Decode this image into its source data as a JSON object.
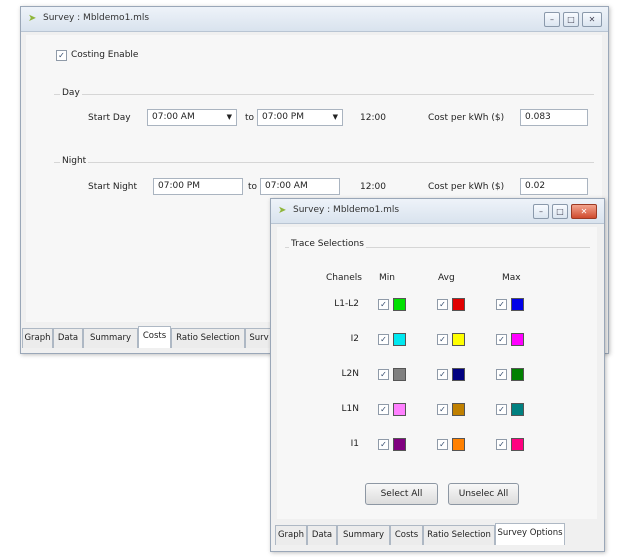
{
  "main_window": {
    "title": "Survey : Mbldemo1.mls",
    "costing_enable_label": "Costing Enable",
    "costing_enable_checked": true,
    "day": {
      "group_label": "Day",
      "start_label": "Start Day",
      "start_value": "07:00 AM",
      "to_label": "to",
      "end_value": "07:00 PM",
      "duration": "12:00",
      "cost_label": "Cost per kWh ($)",
      "cost_value": "0.083"
    },
    "night": {
      "group_label": "Night",
      "start_label": "Start Night",
      "start_value": "07:00 PM",
      "to_label": "to",
      "end_value": "07:00 AM",
      "duration": "12:00",
      "cost_label": "Cost per kWh ($)",
      "cost_value": "0.02"
    },
    "tabs": [
      "Graph",
      "Data",
      "Summary",
      "Costs",
      "Ratio Selection",
      "Surv"
    ],
    "active_tab": "Costs"
  },
  "options_window": {
    "title": "Survey : Mbldemo1.mls",
    "group_label": "Trace Selections",
    "headers": {
      "channels": "Chanels",
      "min": "Min",
      "avg": "Avg",
      "max": "Max"
    },
    "rows": [
      {
        "channel": "L1-L2",
        "min_color": "#00e000",
        "avg_color": "#e00000",
        "max_color": "#0000e8"
      },
      {
        "channel": "I2",
        "min_color": "#00e8f0",
        "avg_color": "#ffff00",
        "max_color": "#ff00ff"
      },
      {
        "channel": "L2N",
        "min_color": "#808080",
        "avg_color": "#000080",
        "max_color": "#008000"
      },
      {
        "channel": "L1N",
        "min_color": "#ff80ff",
        "avg_color": "#c08000",
        "max_color": "#008080"
      },
      {
        "channel": "I1",
        "min_color": "#800080",
        "avg_color": "#ff8000",
        "max_color": "#ff0080"
      }
    ],
    "select_all_label": "Select All",
    "unselect_all_label": "Unselec All",
    "tabs": [
      "Graph",
      "Data",
      "Summary",
      "Costs",
      "Ratio Selection",
      "Survey Options"
    ],
    "active_tab": "Survey Options"
  }
}
